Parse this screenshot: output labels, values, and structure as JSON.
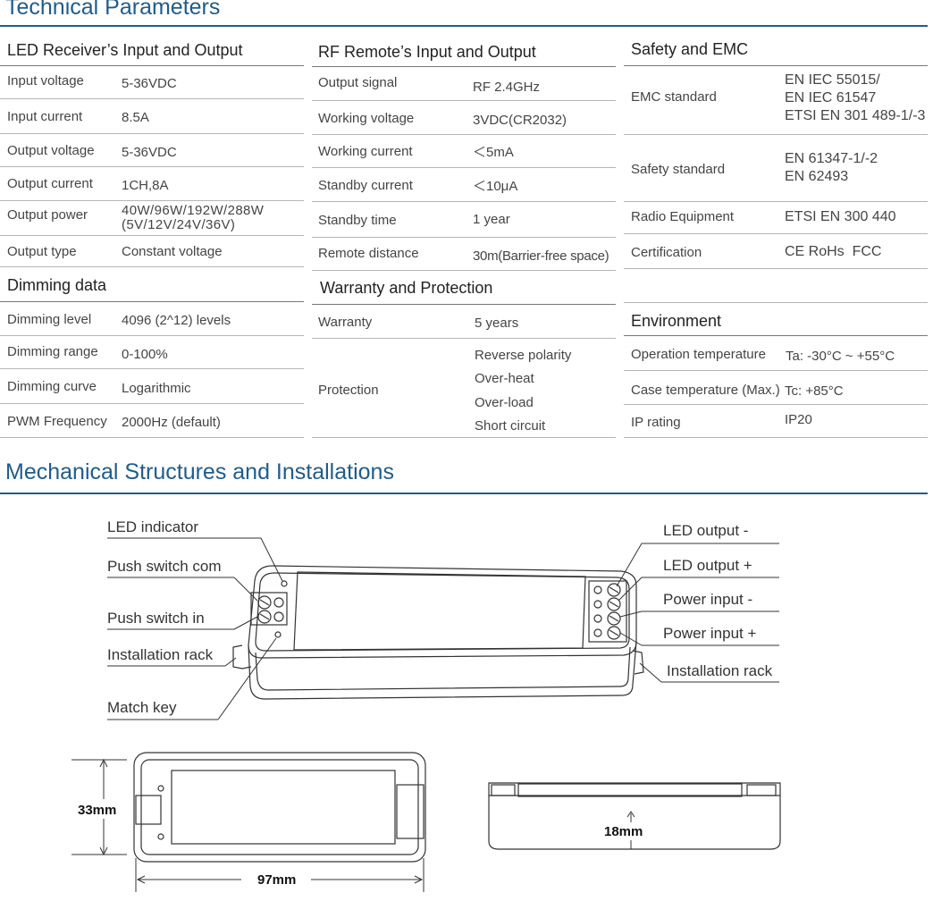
{
  "technical_title": "Technical Parameters",
  "mechanical_title": "Mechanical Structures and Installations",
  "led_receiver": {
    "title": "LED Receiver’s Input and Output",
    "rows": [
      {
        "label": "Input voltage",
        "value": "5-36VDC"
      },
      {
        "label": "Input current",
        "value": "8.5A"
      },
      {
        "label": "Output voltage",
        "value": "5-36VDC"
      },
      {
        "label": "Output current",
        "value": "1CH,8A"
      },
      {
        "label": "Output power",
        "value": "40W/96W/192W/288W",
        "value2": "(5V/12V/24V/36V)"
      },
      {
        "label": "Output type",
        "value": "Constant voltage"
      }
    ]
  },
  "dimming": {
    "title": "Dimming data",
    "rows": [
      {
        "label": "Dimming level",
        "value": "4096 (2^12) levels"
      },
      {
        "label": "Dimming range",
        "value": "0-100%"
      },
      {
        "label": "Dimming curve",
        "value": "Logarithmic"
      },
      {
        "label": "PWM Frequency",
        "value": "2000Hz (default)"
      }
    ]
  },
  "rf_remote": {
    "title": "RF Remote’s Input and Output",
    "rows": [
      {
        "label": "Output signal",
        "value": "RF 2.4GHz"
      },
      {
        "label": "Working voltage",
        "value": "3VDC(CR2032)"
      },
      {
        "label": "Working current",
        "value": "＜5mA"
      },
      {
        "label": "Standby current",
        "value": "＜10μA"
      },
      {
        "label": "Standby time",
        "value": "1 year"
      },
      {
        "label": "Remote distance",
        "value": "30m(Barrier-free space)"
      }
    ]
  },
  "warranty": {
    "title": "Warranty and Protection",
    "warranty_label": "Warranty",
    "warranty_value": "5 years",
    "protection_label": "Protection",
    "protection_values": [
      "Reverse polarity",
      "Over-heat",
      "Over-load",
      "Short circuit"
    ]
  },
  "safety": {
    "title": "Safety and EMC",
    "emc_label": "EMC standard",
    "emc_values": [
      "EN IEC 55015/",
      "EN IEC 61547",
      "ETSI EN 301 489-1/-3"
    ],
    "safety_label": "Safety standard",
    "safety_values": [
      "EN 61347-1/-2",
      "EN 62493"
    ],
    "radio_label": "Radio Equipment",
    "radio_value": "ETSI EN 300 440",
    "cert_label": "Certification",
    "cert_value": "CE RoHs  FCC"
  },
  "environment": {
    "title": "Environment",
    "op_label": "Operation temperature",
    "op_value": "Ta: -30°C ~ +55°C",
    "case_label": "Case temperature (Max.)",
    "case_value": "Tc: +85°C",
    "ip_label": "IP rating",
    "ip_value": "IP20"
  },
  "callouts": {
    "led_indicator": "LED indicator",
    "push_switch_com": "Push switch com",
    "push_switch_in": "Push switch in",
    "installation_rack_left": "Installation rack",
    "match_key": "Match key",
    "led_output_minus": "LED output -",
    "led_output_plus": "LED output +",
    "power_input_minus": "Power input -",
    "power_input_plus": "Power input +",
    "installation_rack_right": "Installation rack"
  },
  "dimensions": {
    "height": "33mm",
    "width": "97mm",
    "depth": "18mm"
  }
}
